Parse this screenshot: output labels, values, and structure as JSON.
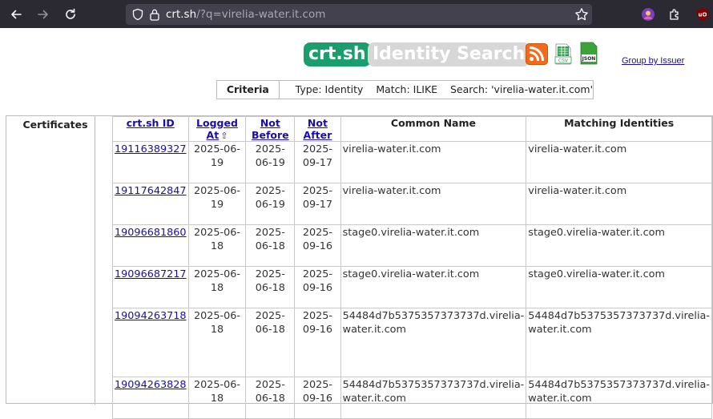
{
  "browser": {
    "url_host": "crt.sh",
    "url_path": "/?q=virelia-water.it.com"
  },
  "header": {
    "logo_main": "crt.sh",
    "logo_sub": "Identity Search",
    "csv_label": "CSV",
    "json_label": "JSON",
    "group_link": "Group by Issuer"
  },
  "criteria": {
    "label": "Criteria",
    "value": "Type: Identity    Match: ILIKE    Search: 'virelia-water.it.com'"
  },
  "certificates": {
    "section_label": "Certificates",
    "columns": {
      "id": "crt.sh ID",
      "logged_at": "Logged At",
      "sort_indicator": "⇧",
      "not_before": "Not Before",
      "not_after": "Not After",
      "common_name": "Common Name",
      "matching_identities": "Matching Identities"
    },
    "rows": [
      {
        "id": "19116389327",
        "logged_at": "2025-06-19",
        "not_before": "2025-06-19",
        "not_after": "2025-09-17",
        "common_name": "virelia-water.it.com",
        "matching": "virelia-water.it.com"
      },
      {
        "id": "19117642847",
        "logged_at": "2025-06-19",
        "not_before": "2025-06-19",
        "not_after": "2025-09-17",
        "common_name": "virelia-water.it.com",
        "matching": "virelia-water.it.com"
      },
      {
        "id": "19096681860",
        "logged_at": "2025-06-18",
        "not_before": "2025-06-18",
        "not_after": "2025-09-16",
        "common_name": "stage0.virelia-water.it.com",
        "matching": "stage0.virelia-water.it.com"
      },
      {
        "id": "19096687217",
        "logged_at": "2025-06-18",
        "not_before": "2025-06-18",
        "not_after": "2025-09-16",
        "common_name": "stage0.virelia-water.it.com",
        "matching": "stage0.virelia-water.it.com"
      },
      {
        "id": "19094263718",
        "logged_at": "2025-06-18",
        "not_before": "2025-06-18",
        "not_after": "2025-09-16",
        "common_name": "54484d7b5375357373737d.virelia-water.it.com",
        "matching": "54484d7b5375357373737d.virelia-water.it.com"
      },
      {
        "id": "19094263828",
        "logged_at": "2025-06-18",
        "not_before": "2025-06-18",
        "not_after": "2025-09-16",
        "common_name": "54484d7b5375357373737d.virelia-water.it.com",
        "matching": "54484d7b5375357373737d.virelia-water.it.com"
      }
    ]
  }
}
